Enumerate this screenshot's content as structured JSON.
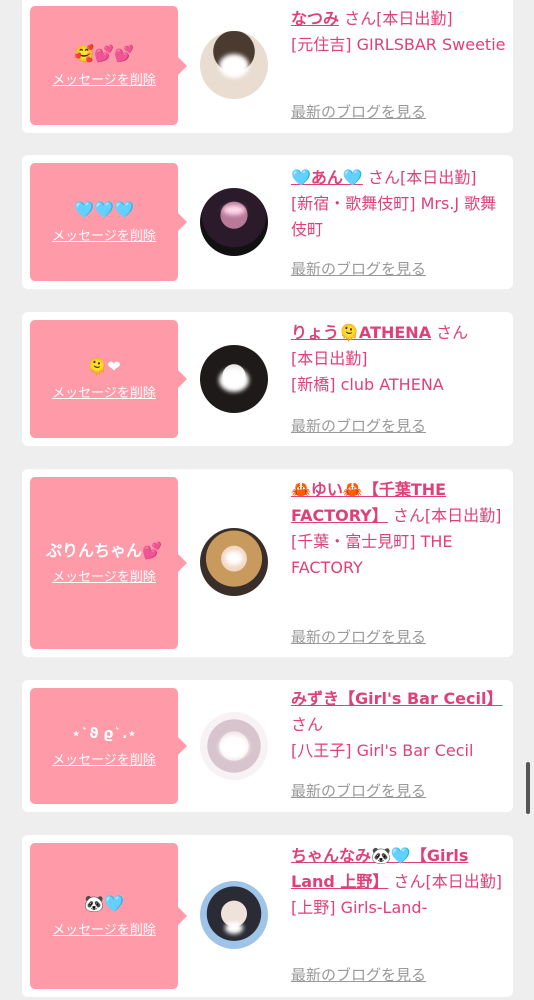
{
  "delete_label": "メッセージを削除",
  "blog_label": "最新のブログを見る",
  "san": "さん",
  "cards": [
    {
      "msg": "🥰💕💕",
      "name": "なつみ",
      "status": "[本日出勤]",
      "shop": "[元住吉] GIRLSBAR Sweetie"
    },
    {
      "msg": "🩵🩵🩵",
      "name": "🩵あん🩵",
      "status": "[本日出勤]",
      "shop": "[新宿・歌舞伎町] Mrs.J 歌舞伎町"
    },
    {
      "msg": "🫠❤",
      "name": "りょう🫠ATHENA",
      "status": "[本日出勤]",
      "shop": "[新橋] club ATHENA"
    },
    {
      "msg": "ぷりんちゃん💕",
      "name": "🦀ゆい🦀【千葉THE FACTORY】",
      "status": "[本日出勤]",
      "shop": "[千葉・富士見町] THE FACTORY"
    },
    {
      "msg": "⋆ ͛ ϑ ϱ ͛ .⋆",
      "name": "みずき【Girl's Bar Cecil】",
      "status": "",
      "shop": "[八王子] Girl's Bar Cecil"
    },
    {
      "msg": "🐼🩵",
      "name": "ちゃんなみ🐼🩵【Girls Land 上野】",
      "status": "[本日出勤]",
      "shop": "[上野] Girls-Land-"
    }
  ],
  "colors": {
    "accent": "#e0407a",
    "message_bg": "#ff9aa9",
    "page_bg": "#eeeeee"
  }
}
